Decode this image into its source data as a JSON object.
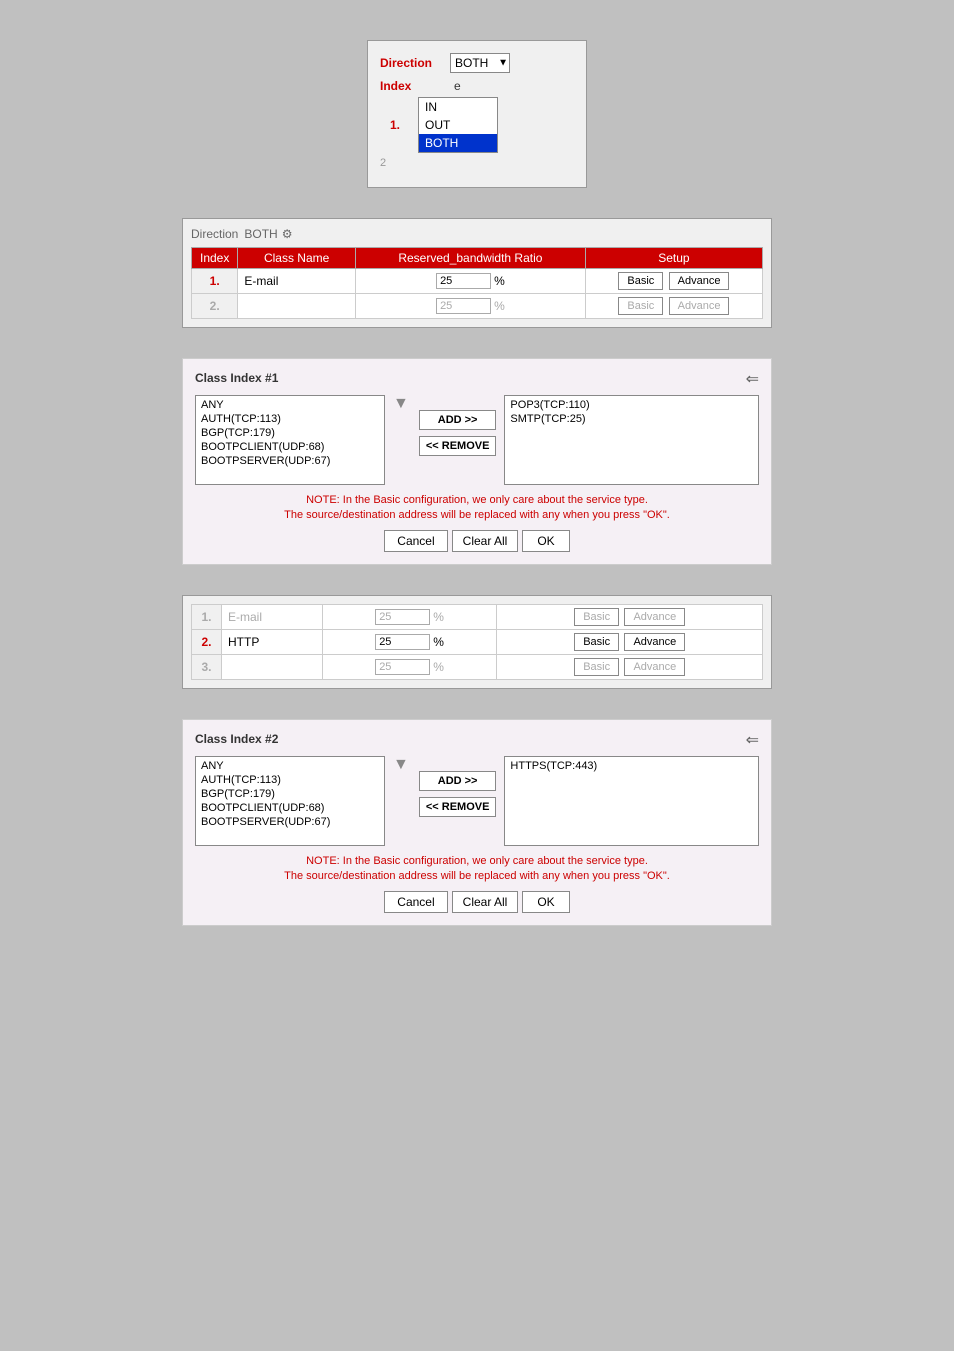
{
  "panel1": {
    "direction_label": "Direction",
    "direction_value": "BOTH",
    "index_label": "Index",
    "dropdown_options": [
      "IN",
      "OUT",
      "BOTH"
    ],
    "selected_option": "BOTH",
    "row_number": "1."
  },
  "panel2": {
    "direction_label": "Direction",
    "direction_value": "BOTH",
    "columns": [
      "Index",
      "Class Name",
      "Reserved_bandwidth Ratio",
      "Setup"
    ],
    "rows": [
      {
        "index": "1.",
        "class_name": "E-mail",
        "bandwidth": "25",
        "percent": "%"
      },
      {
        "index": "2.",
        "class_name": "",
        "bandwidth": "25",
        "percent": "%",
        "dimmed": true
      }
    ],
    "btn_basic": "Basic",
    "btn_advance": "Advance"
  },
  "class_index_1": {
    "title": "Class Index #1",
    "left_list": [
      "ANY",
      "AUTH(TCP:113)",
      "BGP(TCP:179)",
      "BOOTPCLIENT(UDP:68)",
      "BOOTPSERVER(UDP:67)"
    ],
    "right_list": [
      "POP3(TCP:110)",
      "SMTP(TCP:25)"
    ],
    "btn_add": "ADD >>",
    "btn_remove": "<< REMOVE",
    "note_line1": "NOTE: In the Basic configuration, we only care about the service type.",
    "note_line2": "The source/destination address will be replaced with any when you press \"OK\".",
    "btn_cancel": "Cancel",
    "btn_clear_all": "Clear All",
    "btn_ok": "OK"
  },
  "panel4": {
    "rows": [
      {
        "index": "1.",
        "class_name": "E-mail",
        "bandwidth": "25",
        "percent": "%",
        "dimmed": true
      },
      {
        "index": "2.",
        "class_name": "HTTP",
        "bandwidth": "25",
        "percent": "%"
      },
      {
        "index": "3.",
        "class_name": "",
        "bandwidth": "25",
        "percent": "%",
        "dimmed": true
      }
    ],
    "btn_basic": "Basic",
    "btn_advance": "Advance"
  },
  "class_index_2": {
    "title": "Class Index #2",
    "left_list": [
      "ANY",
      "AUTH(TCP:113)",
      "BGP(TCP:179)",
      "BOOTPCLIENT(UDP:68)",
      "BOOTPSERVER(UDP:67)"
    ],
    "right_list": [
      "HTTPS(TCP:443)"
    ],
    "btn_add": "ADD >>",
    "btn_remove": "<< REMOVE",
    "note_line1": "NOTE: In the Basic configuration, we only care about the service type.",
    "note_line2": "The source/destination address will be replaced with any when you press \"OK\".",
    "btn_cancel": "Cancel",
    "btn_clear_all": "Clear All",
    "btn_ok": "OK"
  }
}
